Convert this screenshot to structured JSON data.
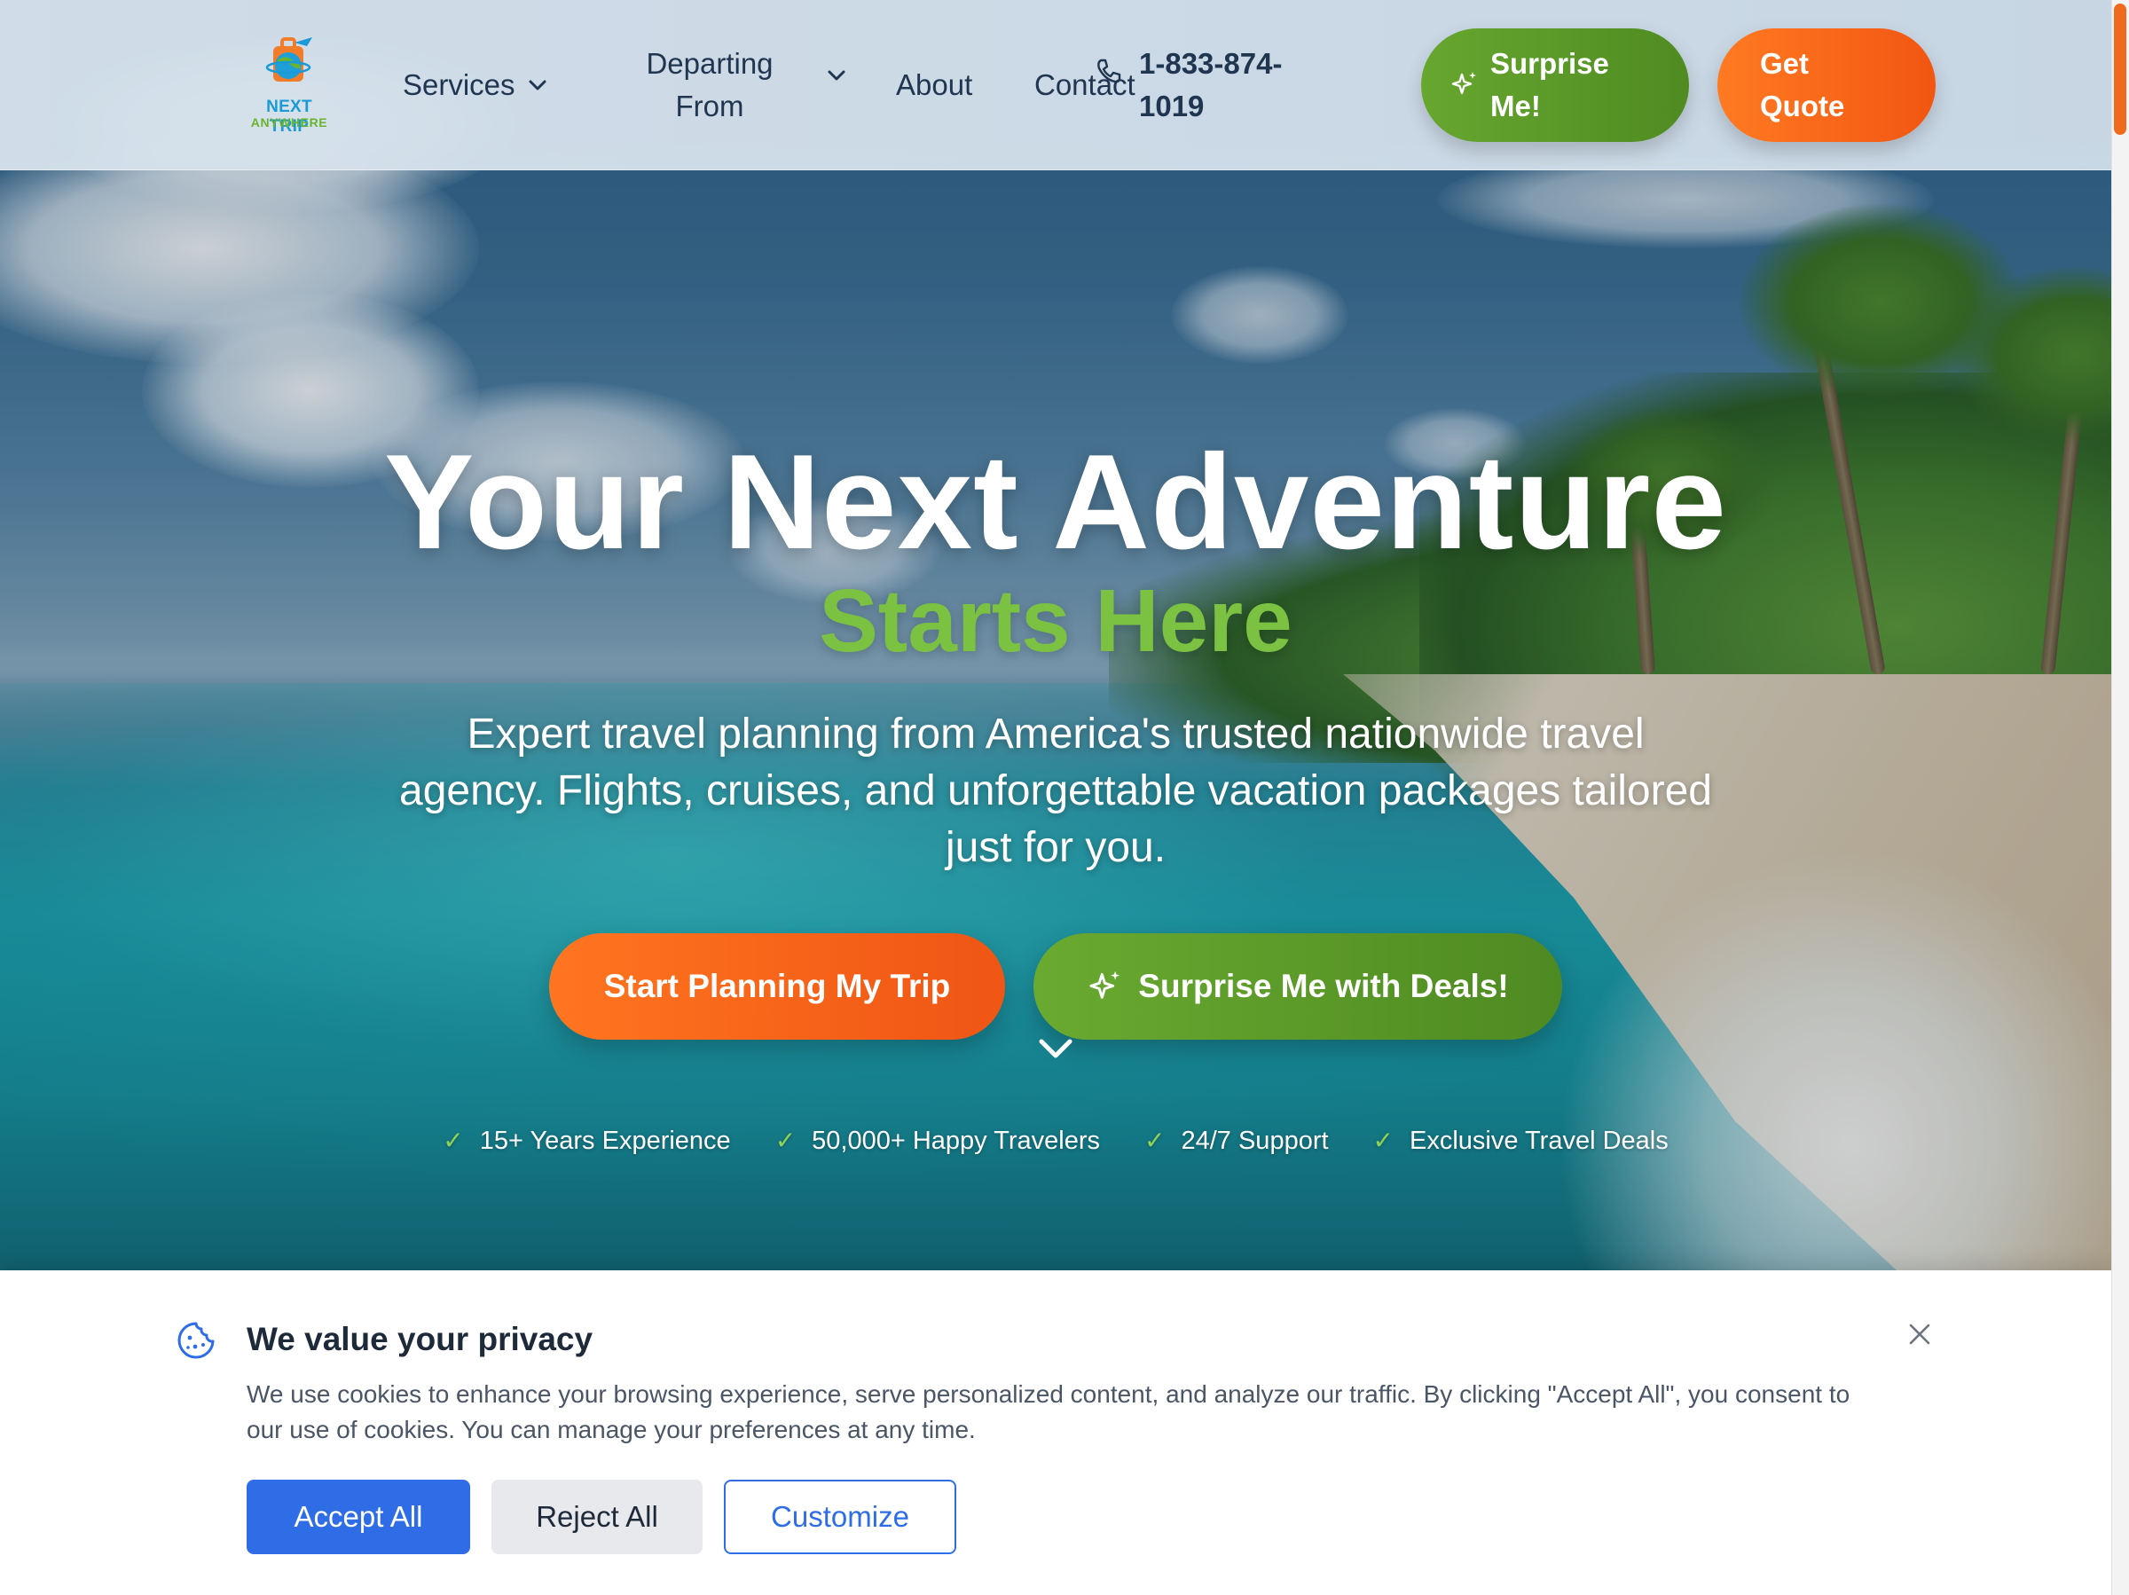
{
  "brand": {
    "logo_line1": "NEXT TRIP",
    "logo_line2": "ANYWHERE",
    "accent_orange": "#f25612",
    "accent_green": "#5a9a28",
    "accent_blue": "#2f6de7"
  },
  "nav": {
    "services": "Services",
    "departing_from": "Departing From",
    "about": "About",
    "contact": "Contact",
    "phone": "1-833-874-1019",
    "surprise_me": "Surprise Me!",
    "get_quote": "Get Quote",
    "icons": {
      "services_chevron": "chevron-down-icon",
      "departing_chevron": "chevron-down-icon",
      "phone": "phone-icon",
      "sparkles": "sparkles-icon"
    }
  },
  "hero": {
    "title": "Your Next Adventure",
    "subtitle": "Starts Here",
    "description": "Expert travel planning from America's trusted nationwide travel agency. Flights, cruises, and unforgettable vacation packages tailored just for you.",
    "cta_primary": "Start Planning My Trip",
    "cta_secondary": "Surprise Me with Deals!",
    "features": [
      "15+ Years Experience",
      "50,000+ Happy Travelers",
      "24/7 Support",
      "Exclusive Travel Deals"
    ]
  },
  "cookie_banner": {
    "title": "We value your privacy",
    "text": "We use cookies to enhance your browsing experience, serve personalized content, and analyze our traffic. By clicking \"Accept All\", you consent to our use of cookies. You can manage your preferences at any time.",
    "accept": "Accept All",
    "reject": "Reject All",
    "customize": "Customize"
  }
}
